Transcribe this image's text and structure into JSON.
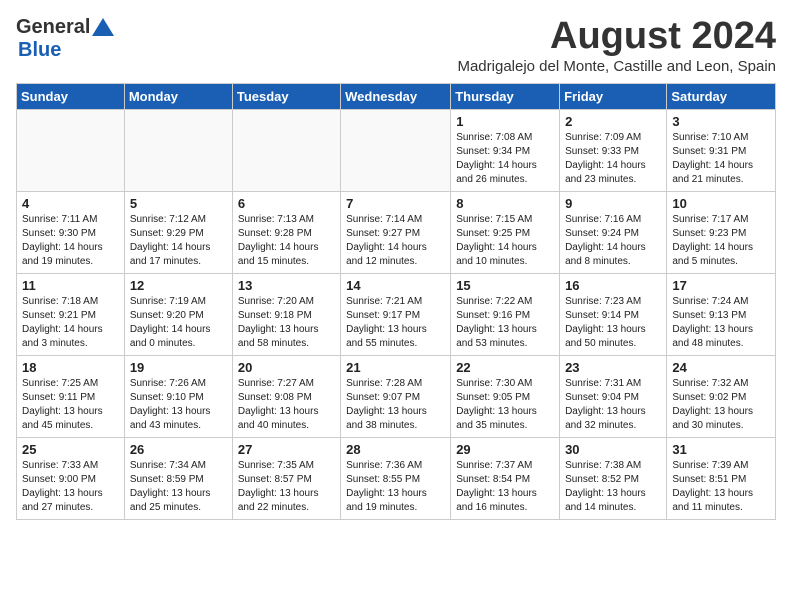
{
  "header": {
    "logo_general": "General",
    "logo_blue": "Blue",
    "month_year": "August 2024",
    "location": "Madrigalejo del Monte, Castille and Leon, Spain"
  },
  "weekdays": [
    "Sunday",
    "Monday",
    "Tuesday",
    "Wednesday",
    "Thursday",
    "Friday",
    "Saturday"
  ],
  "weeks": [
    [
      {
        "day": "",
        "info": ""
      },
      {
        "day": "",
        "info": ""
      },
      {
        "day": "",
        "info": ""
      },
      {
        "day": "",
        "info": ""
      },
      {
        "day": "1",
        "info": "Sunrise: 7:08 AM\nSunset: 9:34 PM\nDaylight: 14 hours\nand 26 minutes."
      },
      {
        "day": "2",
        "info": "Sunrise: 7:09 AM\nSunset: 9:33 PM\nDaylight: 14 hours\nand 23 minutes."
      },
      {
        "day": "3",
        "info": "Sunrise: 7:10 AM\nSunset: 9:31 PM\nDaylight: 14 hours\nand 21 minutes."
      }
    ],
    [
      {
        "day": "4",
        "info": "Sunrise: 7:11 AM\nSunset: 9:30 PM\nDaylight: 14 hours\nand 19 minutes."
      },
      {
        "day": "5",
        "info": "Sunrise: 7:12 AM\nSunset: 9:29 PM\nDaylight: 14 hours\nand 17 minutes."
      },
      {
        "day": "6",
        "info": "Sunrise: 7:13 AM\nSunset: 9:28 PM\nDaylight: 14 hours\nand 15 minutes."
      },
      {
        "day": "7",
        "info": "Sunrise: 7:14 AM\nSunset: 9:27 PM\nDaylight: 14 hours\nand 12 minutes."
      },
      {
        "day": "8",
        "info": "Sunrise: 7:15 AM\nSunset: 9:25 PM\nDaylight: 14 hours\nand 10 minutes."
      },
      {
        "day": "9",
        "info": "Sunrise: 7:16 AM\nSunset: 9:24 PM\nDaylight: 14 hours\nand 8 minutes."
      },
      {
        "day": "10",
        "info": "Sunrise: 7:17 AM\nSunset: 9:23 PM\nDaylight: 14 hours\nand 5 minutes."
      }
    ],
    [
      {
        "day": "11",
        "info": "Sunrise: 7:18 AM\nSunset: 9:21 PM\nDaylight: 14 hours\nand 3 minutes."
      },
      {
        "day": "12",
        "info": "Sunrise: 7:19 AM\nSunset: 9:20 PM\nDaylight: 14 hours\nand 0 minutes."
      },
      {
        "day": "13",
        "info": "Sunrise: 7:20 AM\nSunset: 9:18 PM\nDaylight: 13 hours\nand 58 minutes."
      },
      {
        "day": "14",
        "info": "Sunrise: 7:21 AM\nSunset: 9:17 PM\nDaylight: 13 hours\nand 55 minutes."
      },
      {
        "day": "15",
        "info": "Sunrise: 7:22 AM\nSunset: 9:16 PM\nDaylight: 13 hours\nand 53 minutes."
      },
      {
        "day": "16",
        "info": "Sunrise: 7:23 AM\nSunset: 9:14 PM\nDaylight: 13 hours\nand 50 minutes."
      },
      {
        "day": "17",
        "info": "Sunrise: 7:24 AM\nSunset: 9:13 PM\nDaylight: 13 hours\nand 48 minutes."
      }
    ],
    [
      {
        "day": "18",
        "info": "Sunrise: 7:25 AM\nSunset: 9:11 PM\nDaylight: 13 hours\nand 45 minutes."
      },
      {
        "day": "19",
        "info": "Sunrise: 7:26 AM\nSunset: 9:10 PM\nDaylight: 13 hours\nand 43 minutes."
      },
      {
        "day": "20",
        "info": "Sunrise: 7:27 AM\nSunset: 9:08 PM\nDaylight: 13 hours\nand 40 minutes."
      },
      {
        "day": "21",
        "info": "Sunrise: 7:28 AM\nSunset: 9:07 PM\nDaylight: 13 hours\nand 38 minutes."
      },
      {
        "day": "22",
        "info": "Sunrise: 7:30 AM\nSunset: 9:05 PM\nDaylight: 13 hours\nand 35 minutes."
      },
      {
        "day": "23",
        "info": "Sunrise: 7:31 AM\nSunset: 9:04 PM\nDaylight: 13 hours\nand 32 minutes."
      },
      {
        "day": "24",
        "info": "Sunrise: 7:32 AM\nSunset: 9:02 PM\nDaylight: 13 hours\nand 30 minutes."
      }
    ],
    [
      {
        "day": "25",
        "info": "Sunrise: 7:33 AM\nSunset: 9:00 PM\nDaylight: 13 hours\nand 27 minutes."
      },
      {
        "day": "26",
        "info": "Sunrise: 7:34 AM\nSunset: 8:59 PM\nDaylight: 13 hours\nand 25 minutes."
      },
      {
        "day": "27",
        "info": "Sunrise: 7:35 AM\nSunset: 8:57 PM\nDaylight: 13 hours\nand 22 minutes."
      },
      {
        "day": "28",
        "info": "Sunrise: 7:36 AM\nSunset: 8:55 PM\nDaylight: 13 hours\nand 19 minutes."
      },
      {
        "day": "29",
        "info": "Sunrise: 7:37 AM\nSunset: 8:54 PM\nDaylight: 13 hours\nand 16 minutes."
      },
      {
        "day": "30",
        "info": "Sunrise: 7:38 AM\nSunset: 8:52 PM\nDaylight: 13 hours\nand 14 minutes."
      },
      {
        "day": "31",
        "info": "Sunrise: 7:39 AM\nSunset: 8:51 PM\nDaylight: 13 hours\nand 11 minutes."
      }
    ]
  ]
}
